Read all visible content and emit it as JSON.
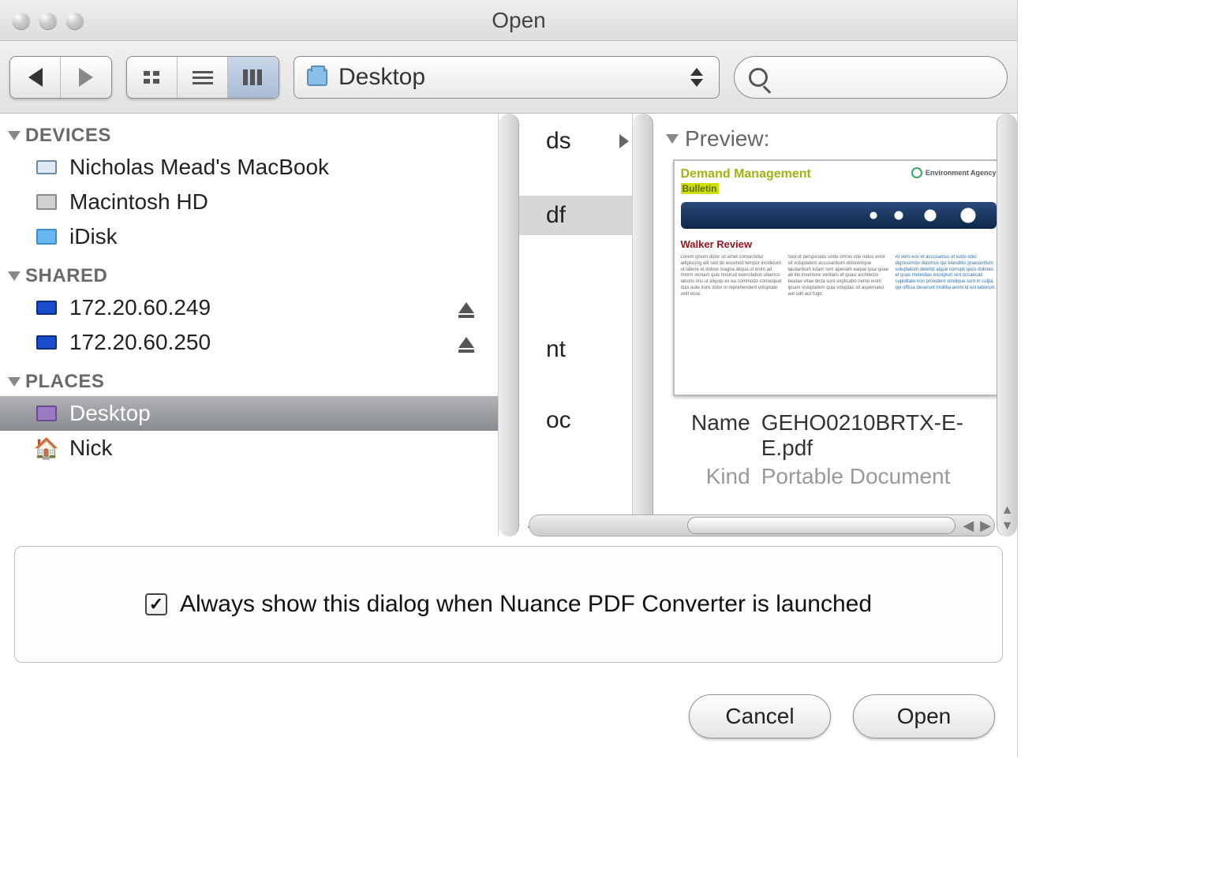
{
  "window": {
    "title": "Open"
  },
  "toolbar": {
    "location_label": "Desktop",
    "search_placeholder": ""
  },
  "sidebar": {
    "groups": [
      {
        "name": "DEVICES",
        "items": [
          {
            "label": "Nicholas Mead's MacBook",
            "icon": "macbook",
            "eject": false
          },
          {
            "label": "Macintosh HD",
            "icon": "hdd",
            "eject": false
          },
          {
            "label": "iDisk",
            "icon": "idisk",
            "eject": false
          }
        ]
      },
      {
        "name": "SHARED",
        "items": [
          {
            "label": "172.20.60.249",
            "icon": "net",
            "eject": true
          },
          {
            "label": "172.20.60.250",
            "icon": "net",
            "eject": true
          }
        ]
      },
      {
        "name": "PLACES",
        "items": [
          {
            "label": "Desktop",
            "icon": "desktop",
            "eject": false,
            "selected": true
          },
          {
            "label": "Nick",
            "icon": "home",
            "eject": false
          }
        ]
      }
    ]
  },
  "file_column": {
    "rows": [
      {
        "text": "ds",
        "nav": true
      },
      {
        "text": "df",
        "nav": false,
        "selected": true
      },
      {
        "text": "nt",
        "nav": false
      },
      {
        "text": "oc",
        "nav": false
      }
    ]
  },
  "preview": {
    "header": "Preview:",
    "name_label": "Name",
    "name_value": "GEHO0210BRTX-E-E.pdf",
    "kind_label": "Kind",
    "kind_value": "Portable Document",
    "thumb": {
      "brand1": "Demand Management",
      "brand2": "Bulletin",
      "logo_text": "Environment Agency",
      "headline": "Walker Review"
    }
  },
  "options": {
    "checkbox_checked": true,
    "label": "Always show this dialog when Nuance PDF Converter is launched"
  },
  "buttons": {
    "cancel": "Cancel",
    "open": "Open"
  }
}
